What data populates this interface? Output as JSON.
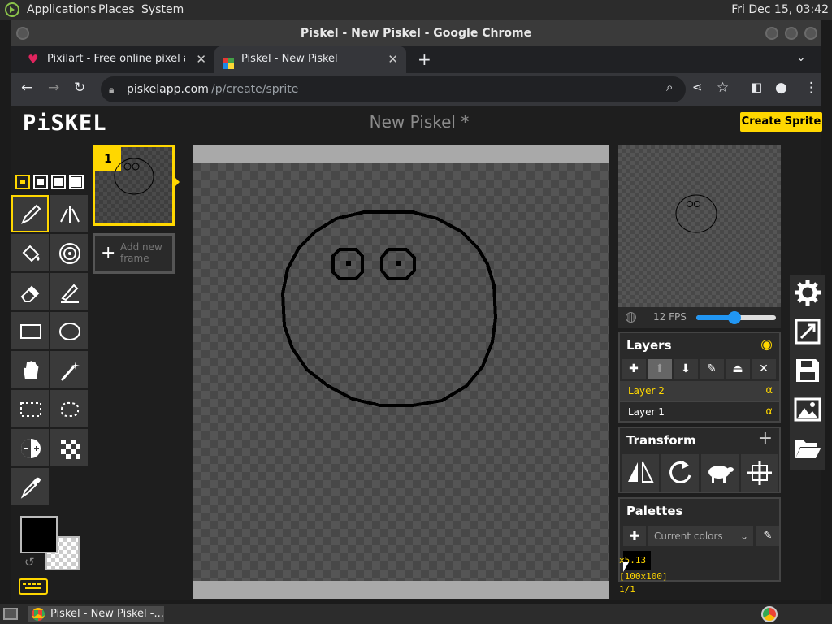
{
  "panel": {
    "applications": "Applications",
    "places": "Places",
    "system": "System",
    "clock": "Fri Dec 15, 03:42"
  },
  "window": {
    "title": "Piskel - New Piskel - Google Chrome"
  },
  "tabs": [
    {
      "label": "Pixilart - Free online pixel art",
      "favicon": "heart-icon",
      "color": "#e0245e"
    },
    {
      "label": "Piskel - New Piskel",
      "favicon": "piskel-favicon-icon"
    }
  ],
  "address": {
    "domain": "piskelapp.com",
    "path": "/p/create/sprite"
  },
  "app": {
    "logo": "PiSKEL",
    "sprite_title": "New Piskel *",
    "create_label": "Create Sprite",
    "accent": "#ffd700"
  },
  "frames": {
    "current": "1",
    "add_line1": "Add new",
    "add_line2": "frame"
  },
  "preview": {
    "fps_label": "12 FPS",
    "fps_value": 12
  },
  "layers": {
    "title": "Layers",
    "items": [
      {
        "name": "Layer 2",
        "alpha": "α",
        "active": true
      },
      {
        "name": "Layer 1",
        "alpha": "α",
        "active": false
      }
    ]
  },
  "transform": {
    "title": "Transform"
  },
  "palettes": {
    "title": "Palettes",
    "selected": "Current colors"
  },
  "status": {
    "zoom": "x5.13",
    "size": "[100x100]",
    "frame": "1/1"
  },
  "colors": {
    "primary": "#000000",
    "secondary": "transparent"
  },
  "taskbar": {
    "item": "Piskel - New Piskel -..."
  }
}
